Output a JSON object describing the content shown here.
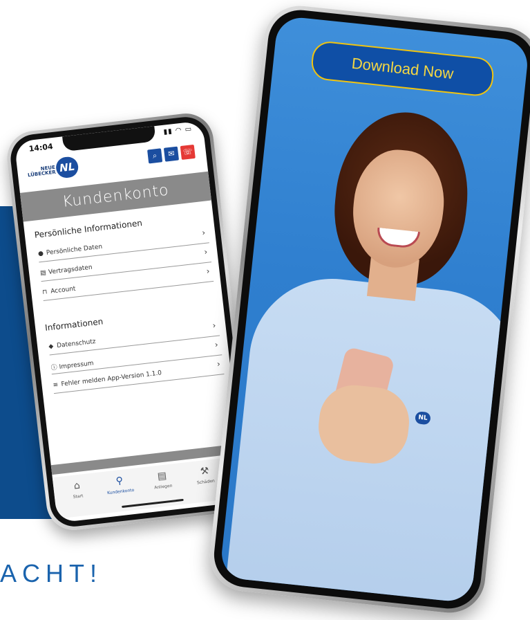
{
  "colors": {
    "brand_blue": "#1b4ea0",
    "dark_band": "#0d4c8c",
    "accent_yellow": "#f1c40f",
    "header_grey": "#8a8a8a",
    "alert_red": "#e53935"
  },
  "bottom_text": "ACHT!",
  "left_phone": {
    "status_time": "14:04",
    "status_icons": "signal wifi battery",
    "logo": {
      "line1": "NEUE",
      "line2": "LÜBECKER",
      "badge": "NL"
    },
    "header_buttons": [
      {
        "icon": "search-icon",
        "glyph": "⌕"
      },
      {
        "icon": "chat-icon",
        "glyph": "✉"
      },
      {
        "icon": "phone-alert-icon",
        "glyph": "☏"
      }
    ],
    "page_title": "Kundenkonto",
    "sections": [
      {
        "title": "Persönliche Informationen",
        "items": [
          {
            "label": "Persönliche Daten",
            "icon": "user-icon",
            "glyph": "●"
          },
          {
            "label": "Vertragsdaten",
            "icon": "document-icon",
            "glyph": "▤"
          },
          {
            "label": "Account",
            "icon": "lock-icon",
            "glyph": "⊓"
          }
        ]
      },
      {
        "title": "Informationen",
        "items": [
          {
            "label": "Datenschutz",
            "icon": "shield-icon",
            "glyph": "◆"
          },
          {
            "label": "Impressum",
            "icon": "info-icon",
            "glyph": "ⓘ"
          },
          {
            "label": "Fehler melden App-Version 1.1.0",
            "icon": "database-icon",
            "glyph": "≡"
          }
        ]
      }
    ],
    "tabs": [
      {
        "label": "Start",
        "icon": "home-icon",
        "glyph": "⌂",
        "active": false
      },
      {
        "label": "Kundenkonto",
        "icon": "person-icon",
        "glyph": "⚲",
        "active": true
      },
      {
        "label": "Anliegen",
        "icon": "document-icon",
        "glyph": "▤",
        "active": false
      },
      {
        "label": "Schäden",
        "icon": "tools-icon",
        "glyph": "⚒",
        "active": false
      }
    ]
  },
  "right_phone": {
    "download_button": "Download Now",
    "shirt_logo": "NL"
  }
}
